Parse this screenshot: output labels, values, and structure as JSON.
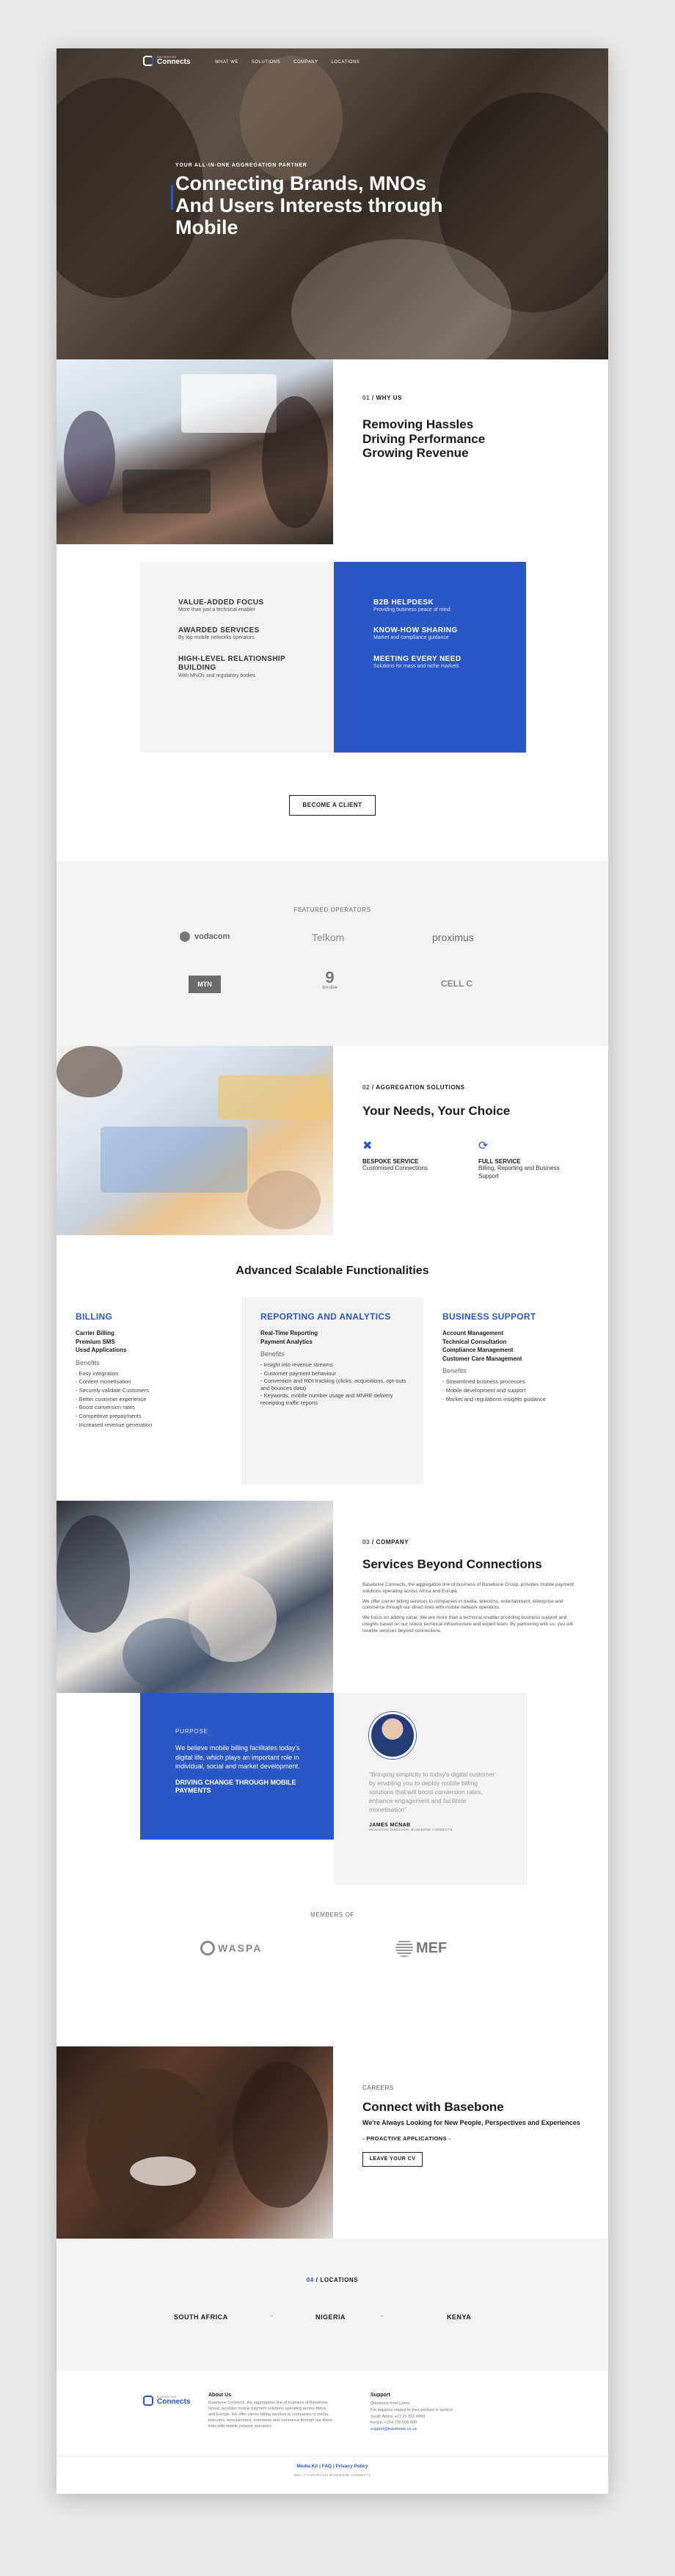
{
  "nav": {
    "brand_small": "BASEBONE",
    "brand": "Connects",
    "items": [
      "WHAT WE",
      "SOLUTIONS",
      "COMPANY",
      "LOCATIONS"
    ]
  },
  "hero": {
    "eyebrow": "YOUR ALL-IN-ONE AGGREGATION PARTNER",
    "title_1": "Connecting Brands, MNOs",
    "title_2": "And Users Interests through",
    "title_3": "Mobile"
  },
  "why": {
    "eyebrow_num": "01",
    "eyebrow": " / WHY US",
    "title_1": "Removing Hassles",
    "title_2": "Driving Performance",
    "title_3": "Growing Revenue"
  },
  "values": {
    "left": [
      {
        "title": "VALUE-ADDED FOCUS",
        "desc": "More than just a technical enabler"
      },
      {
        "title": "AWARDED SERVICES",
        "desc": "By top mobile networks operators"
      },
      {
        "title": "HIGH-LEVEL RELATIONSHIP BUILDING",
        "desc": "With MNOs and regulatory bodies"
      }
    ],
    "right": [
      {
        "title": "B2B HELPDESK",
        "desc": "Providing business peace of mind"
      },
      {
        "title": "KNOW-HOW SHARING",
        "desc": "Market and compliance guidance"
      },
      {
        "title": "MEETING EVERY NEED",
        "desc": "Solutions for mass and niche markets"
      }
    ],
    "cta": "BECOME A CLIENT"
  },
  "operators": {
    "heading": "FEATURED OPERATORS",
    "logos": [
      "vodacom",
      "Telkom",
      "proximus",
      "MTN",
      "9mobile",
      "CELL C"
    ]
  },
  "solutions": {
    "eyebrow_num": "02",
    "eyebrow": " / AGGREGATION SOLUTIONS",
    "title": "Your Needs, Your Choice",
    "items": [
      {
        "title": "BESPOKE SERVICE",
        "desc": "Customised Connections"
      },
      {
        "title": "FULL SERVICE",
        "desc": "Billing, Reporting and Business Support"
      }
    ]
  },
  "functionalities": {
    "title": "Advanced Scalable Functionalities",
    "benefits_label": "Benefits",
    "columns": [
      {
        "title": "BILLING",
        "features": [
          "Carrier Billing",
          "Premium SMS",
          "Ussd Applications"
        ],
        "benefits": [
          "- Easy integration",
          "- Content monetisation",
          "- Securely validate Customers",
          "- Better customer experience",
          "- Boost conversion rates",
          "- Competitive prepayments",
          "- Increased revenue generation"
        ]
      },
      {
        "title": "REPORTING AND ANALYTICS",
        "features": [
          "Real-Time Reporting",
          "Payment Analytics"
        ],
        "benefits": [
          "- Insight into revenue streams",
          "- Customer payment behaviour",
          "- Convention and ROI tracking (clicks, acquisitions, opt-outs and bounces data)",
          "- Keywords, mobile number usage and MNRE delivery receipting traffic reports"
        ]
      },
      {
        "title": "BUSINESS SUPPORT",
        "features": [
          "Account Management",
          "Technical Consultation",
          "Compliance Management",
          "Customer Care Management"
        ],
        "benefits": [
          "- Streamlined business processes",
          "- Mobile development and support",
          "- Market and regulations insights guidance"
        ]
      }
    ]
  },
  "company": {
    "eyebrow_num": "03",
    "eyebrow": " / COMPANY",
    "title": "Services Beyond Connections",
    "p1": "Basebone Connects, the aggregation line of business of Basebone Group, provides mobile payment solutions operating across Africa and Europe.",
    "p2": "We offer carrier billing services to companies in media, telecoms, entertainment, enterprise and commerce through our direct links with mobile network operators.",
    "p3": "We focus on adding value. We are more than a technical enabler providing business support and insights based on our robust technical infrastructure and expert team. By partnering with us, you will receive services beyond connections.",
    "purpose_label": "PURPOSE",
    "purpose_text": "We believe mobile billing facilitates today's digital life, which plays an important role in individual, social and market development.",
    "purpose_cta": "DRIVING CHANGE THROUGH MOBILE PAYMENTS",
    "quote": "\"Bringing simplicity to today's digital customer by enabling you to deploy mobile billing solutions that will boost conversion rates, enhance engagement and facilitate monetisation\"",
    "quote_name": "JAMES MCNAB",
    "quote_role": "MANAGING DIRECTOR, BASEBONE CONNECTS"
  },
  "members": {
    "heading": "MEMBERS OF",
    "logos": [
      "WASPA",
      "MEF"
    ]
  },
  "careers": {
    "eyebrow": "CAREERS",
    "title": "Connect with Basebone",
    "subtitle": "We're Always Looking for New People, Perspectives and Experiences",
    "tagline": "- PROACTIVE APPLICATIONS -",
    "cta": "LEAVE YOUR CV"
  },
  "locations": {
    "eyebrow_num": "04",
    "eyebrow": " / LOCATIONS",
    "items": [
      "SOUTH AFRICA",
      "NIGERIA",
      "KENYA"
    ]
  },
  "footer": {
    "about_title": "About Us",
    "about_text": "Basebone Connects, the aggregation line of business of Basebone Group, provides mobile payment solutions operating across Africa and Europe. We offer carrier billing services to companies in media, telecoms, entertainment, enterprise and commerce through our direct links with mobile network operators.",
    "support_title": "Support",
    "support_lines": [
      "Questions from Users",
      "For inquiries related to your product or service",
      "South Africa: +27 21 001 0000",
      "Kenya: +254 700 000 000",
      "support@basebone.co.za"
    ],
    "links": "Media Kit | FAQ | Privacy Policy",
    "copyright": "2021 © COPYRIGHT BASEBONE CONNECTS"
  }
}
